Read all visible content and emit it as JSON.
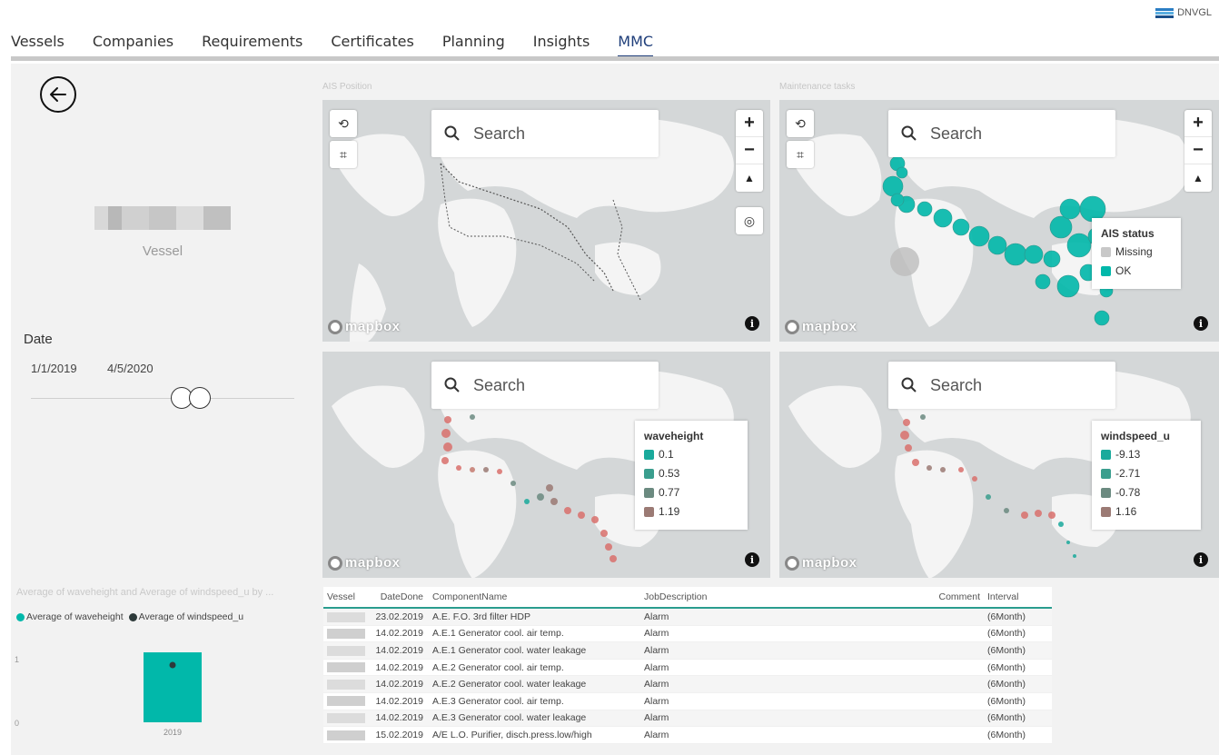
{
  "brand": {
    "name": "DNVGL"
  },
  "nav": {
    "tabs": [
      {
        "label": "Vessels"
      },
      {
        "label": "Companies"
      },
      {
        "label": "Requirements"
      },
      {
        "label": "Certificates"
      },
      {
        "label": "Planning"
      },
      {
        "label": "Insights"
      },
      {
        "label": "MMC",
        "active": true
      }
    ]
  },
  "left_panel": {
    "vessel_label": "Vessel",
    "date_label": "Date",
    "date_start": "1/1/2019",
    "date_end": "4/5/2020"
  },
  "mini_chart": {
    "title": "Average of waveheight and Average of windspeed_u by ...",
    "legend": [
      {
        "name": "Average of waveheight",
        "color": "#01b8aa"
      },
      {
        "name": "Average of windspeed_u",
        "color": "#2d3a3a"
      }
    ],
    "chart_data": {
      "type": "bar",
      "categories": [
        "2019"
      ],
      "series": [
        {
          "name": "Average of waveheight",
          "values": [
            1.1
          ]
        },
        {
          "name": "Average of windspeed_u",
          "values": [
            0.9
          ]
        }
      ],
      "yticks": [
        "1",
        "0"
      ]
    }
  },
  "maps": {
    "ais_title": "AIS Position",
    "maint_title": "Maintenance tasks",
    "search_placeholder": "Search",
    "attribution": "mapbox",
    "info_glyph": "i",
    "ais_status": {
      "title": "AIS status",
      "items": [
        {
          "label": "Missing",
          "color": "#c8c8c8"
        },
        {
          "label": "OK",
          "color": "#01b8aa"
        }
      ]
    },
    "waveheight": {
      "title": "waveheight",
      "items": [
        {
          "label": "0.1",
          "color": "#1aaa9c"
        },
        {
          "label": "0.53",
          "color": "#3a9e8e"
        },
        {
          "label": "0.77",
          "color": "#6b8a80"
        },
        {
          "label": "1.19",
          "color": "#9b7a74"
        }
      ]
    },
    "windspeed": {
      "title": "windspeed_u",
      "items": [
        {
          "label": "-9.13",
          "color": "#1aaa9c"
        },
        {
          "label": "-2.71",
          "color": "#3a9e8e"
        },
        {
          "label": "-0.78",
          "color": "#6b8a80"
        },
        {
          "label": "1.16",
          "color": "#9b7a74"
        }
      ]
    }
  },
  "table": {
    "headers": [
      "Vessel",
      "DateDone",
      "ComponentName",
      "JobDescription",
      "Comment",
      "Interval"
    ],
    "rows": [
      {
        "date": "23.02.2019",
        "component": "A.E. F.O. 3rd filter HDP",
        "job": "Alarm",
        "interval": "(6Month)"
      },
      {
        "date": "14.02.2019",
        "component": "A.E.1 Generator cool. air temp.",
        "job": "Alarm",
        "interval": "(6Month)"
      },
      {
        "date": "14.02.2019",
        "component": "A.E.1 Generator cool. water leakage",
        "job": "Alarm",
        "interval": "(6Month)"
      },
      {
        "date": "14.02.2019",
        "component": "A.E.2 Generator cool. air temp.",
        "job": "Alarm",
        "interval": "(6Month)"
      },
      {
        "date": "14.02.2019",
        "component": "A.E.2 Generator cool. water leakage",
        "job": "Alarm",
        "interval": "(6Month)"
      },
      {
        "date": "14.02.2019",
        "component": "A.E.3 Generator cool. air temp.",
        "job": "Alarm",
        "interval": "(6Month)"
      },
      {
        "date": "14.02.2019",
        "component": "A.E.3 Generator cool. water leakage",
        "job": "Alarm",
        "interval": "(6Month)"
      },
      {
        "date": "15.02.2019",
        "component": "A/E L.O. Purifier, disch.press.low/high",
        "job": "Alarm",
        "interval": "(6Month)"
      }
    ]
  }
}
